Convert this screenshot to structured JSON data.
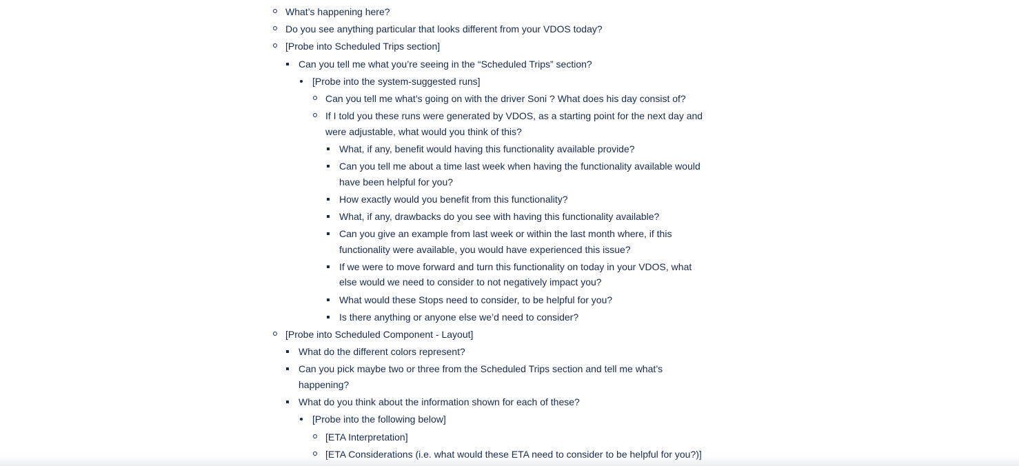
{
  "items": [
    {
      "level": 1,
      "bullet": "circle",
      "text": "What’s happening here?"
    },
    {
      "level": 1,
      "bullet": "circle",
      "text": "Do you see anything particular that looks different from your VDOS today?"
    },
    {
      "level": 1,
      "bullet": "circle",
      "text": "[Probe into Scheduled Trips section]"
    },
    {
      "level": 2,
      "bullet": "square",
      "text": "Can you tell me what you’re seeing in the “Scheduled Trips” section?"
    },
    {
      "level": 3,
      "bullet": "dot",
      "text": "[Probe into the system-suggested runs]"
    },
    {
      "level": 4,
      "bullet": "circle",
      "text": "Can you tell me what’s going on with the driver Soni ? What does his day consist of?"
    },
    {
      "level": 4,
      "bullet": "circle",
      "text": "If I told you these runs were generated by VDOS, as a starting point for the next day and",
      "cont": "were adjustable, what would you think of this?"
    },
    {
      "level": 5,
      "bullet": "square",
      "text": "What, if any, benefit would having this functionality available provide?"
    },
    {
      "level": 5,
      "bullet": "square",
      "text": "Can you tell me about a time last week when having the functionality available would",
      "cont": "have been helpful for you?"
    },
    {
      "level": 5,
      "bullet": "square",
      "text": "How exactly would you benefit from this functionality?"
    },
    {
      "level": 5,
      "bullet": "square",
      "text": "What, if any, drawbacks do you see with having this functionality available?"
    },
    {
      "level": 5,
      "bullet": "square",
      "text": "Can you give an example from last week or within the last month where, if this",
      "cont": "functionality were available, you would have experienced this issue?"
    },
    {
      "level": 5,
      "bullet": "square",
      "text": "If we were to move forward and turn this functionality on today in your VDOS, what",
      "cont": "else would we need to consider to not negatively impact you?"
    },
    {
      "level": 5,
      "bullet": "square",
      "text": "What would these Stops need to consider, to be helpful for you?"
    },
    {
      "level": 5,
      "bullet": "square",
      "text": "Is there anything or anyone else we’d need to consider?"
    },
    {
      "level": 1,
      "bullet": "circle",
      "text": "[Probe into Scheduled Component - Layout]"
    },
    {
      "level": 2,
      "bullet": "square",
      "text": "What do the different colors represent?"
    },
    {
      "level": 2,
      "bullet": "square",
      "text": "Can you pick maybe two or three from the Scheduled Trips section and tell me what’s",
      "cont": "happening?"
    },
    {
      "level": 2,
      "bullet": "square",
      "text": "What do you think about the information shown for each of these?"
    },
    {
      "level": 3,
      "bullet": "dot",
      "text": "[Probe into the following below]"
    },
    {
      "level": 4,
      "bullet": "circle",
      "text": "[ETA Interpretation]"
    },
    {
      "level": 4,
      "bullet": "circle",
      "text": "[ETA Considerations (i.e. what would these ETA need to consider to be helpful for you?)]"
    }
  ]
}
